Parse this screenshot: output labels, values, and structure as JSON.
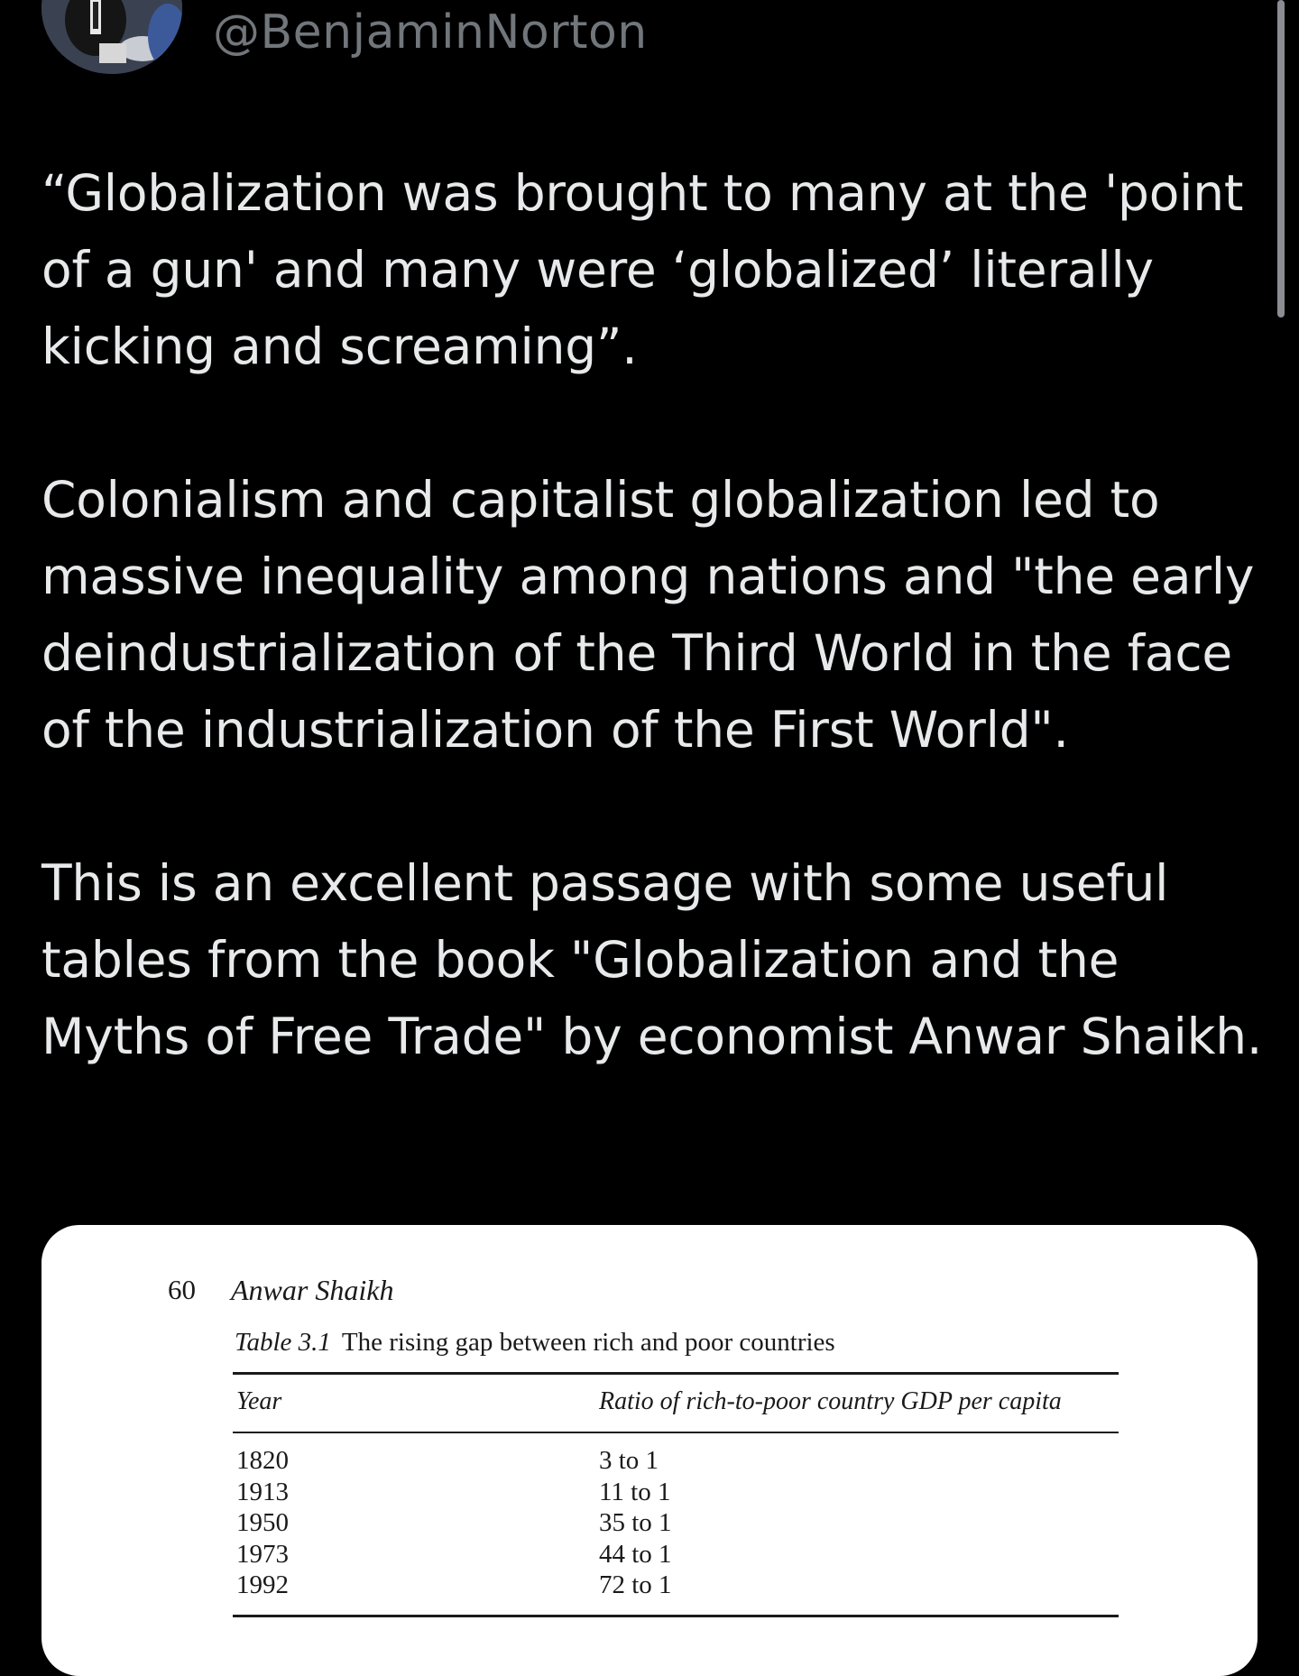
{
  "tweet": {
    "handle": "@BenjaminNorton",
    "paragraphs": [
      "“Globalization was brought to many at the 'point of a gun' and many were ‘globalized’ literally kicking and screaming”.",
      "Colonialism and capitalist globalization led to massive inequality among nations and \"the early deindustrialization of the Third World in the face of the industrialization of the First World\".",
      "This is an excellent passage with some useful tables from the book \"Globalization and the Myths of Free Trade\" by economist Anwar Shaikh."
    ]
  },
  "media": {
    "page_number": "60",
    "author": "Anwar Shaikh",
    "table_label": "Table 3.1",
    "table_title": "The rising gap between rich and poor countries",
    "columns": [
      "Year",
      "Ratio of rich-to-poor country GDP per capita"
    ],
    "rows": [
      [
        "1820",
        "3 to 1"
      ],
      [
        "1913",
        "11 to 1"
      ],
      [
        "1950",
        "35 to 1"
      ],
      [
        "1973",
        "44 to 1"
      ],
      [
        "1992",
        "72 to 1"
      ]
    ]
  },
  "colors": {
    "background": "#000000",
    "text": "#e7e9ea",
    "handle": "#71767b",
    "card": "#ffffff"
  },
  "icons": {
    "avatar": "profile-photo"
  }
}
